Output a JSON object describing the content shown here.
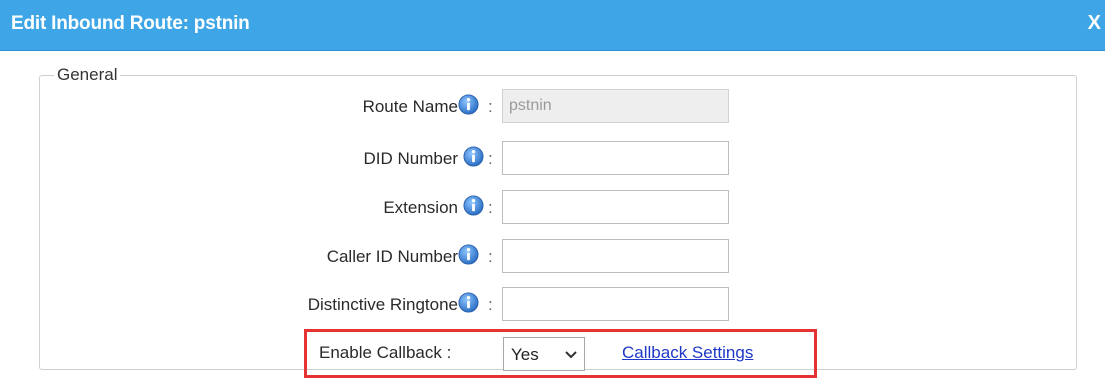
{
  "dialog": {
    "title": "Edit Inbound Route: pstnin",
    "close_label": "X"
  },
  "general": {
    "legend": "General",
    "separator": ":",
    "fields": [
      {
        "label": "Route Name",
        "value": "pstnin",
        "disabled": true
      },
      {
        "label": "DID Number",
        "value": ""
      },
      {
        "label": "Extension",
        "value": ""
      },
      {
        "label": "Caller ID Number",
        "value": ""
      },
      {
        "label": "Distinctive Ringtone",
        "value": ""
      }
    ],
    "enable_callback": {
      "label": "Enable Callback :",
      "selected": "Yes"
    },
    "callback_settings_link": "Callback Settings"
  },
  "icons": {
    "info": "info-icon",
    "dropdown": "chevron-down-icon"
  },
  "colors": {
    "titlebar": "#3ea6e6",
    "info_icon": "#3a7fd0",
    "highlight": "#e53333",
    "link": "#1f38c9"
  }
}
